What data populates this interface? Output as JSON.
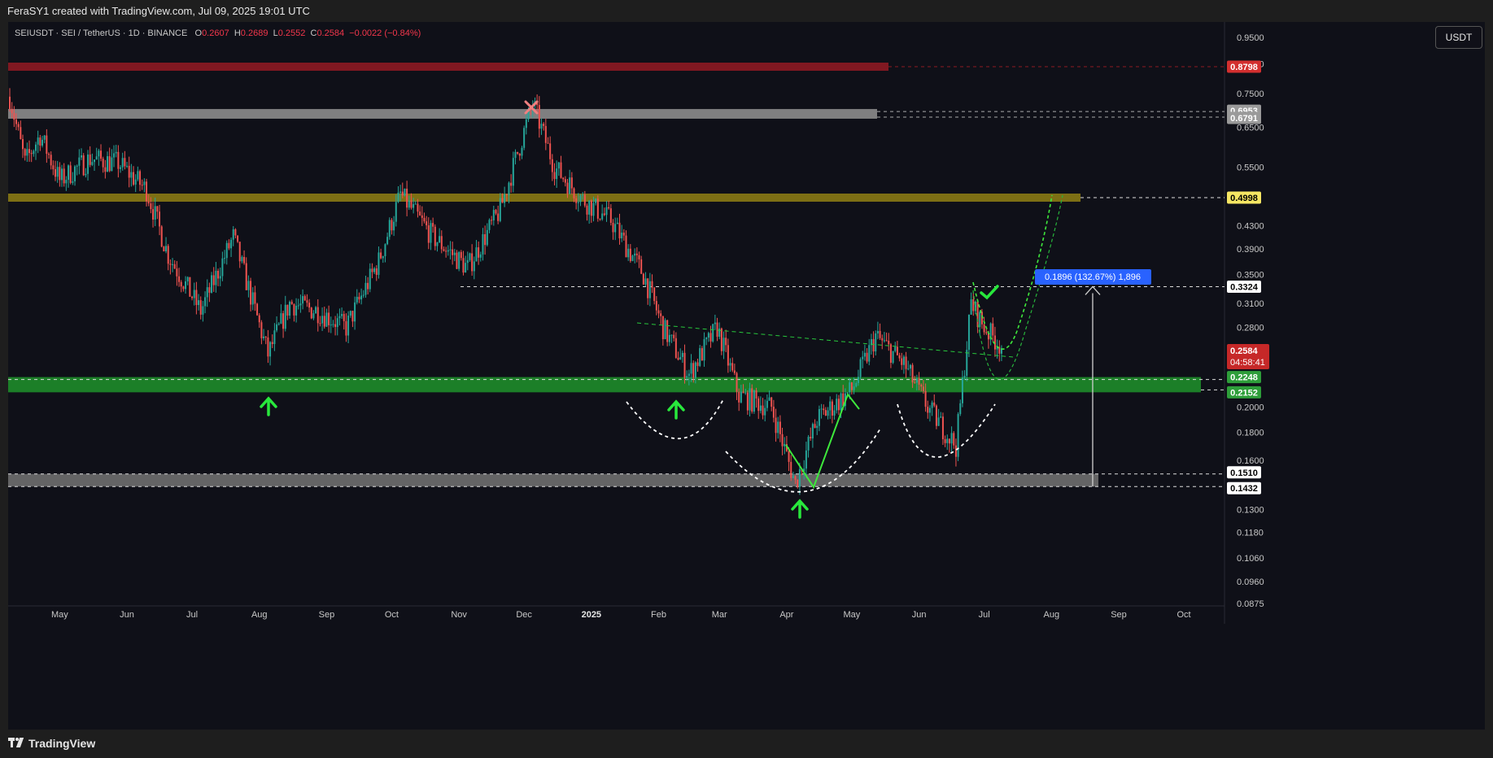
{
  "header": {
    "title": "FeraSY1 created with TradingView.com, Jul 09, 2025 19:01 UTC"
  },
  "footer": {
    "brand": "TradingView"
  },
  "toolbar": {
    "currency_button": "USDT"
  },
  "legend": {
    "symbol": "SEIUSDT · SEI / TetherUS · 1D · BINANCE",
    "o_label": "O",
    "o_value": "0.2607",
    "h_label": "H",
    "h_value": "0.2689",
    "l_label": "L",
    "l_value": "0.2552",
    "c_label": "C",
    "c_value": "0.2584",
    "change": "−0.0022 (−0.84%)"
  },
  "colors": {
    "background": "#0f1018",
    "up": "#26a69a",
    "down": "#ef5350",
    "green_zone": "#1e8c2a",
    "red_zone": "#8e1a22",
    "yellow_zone": "#8a7a14",
    "gray_zone": "#8c8c8c",
    "arrow_green": "#28e83c",
    "measure_label": "#2962ff"
  },
  "chart_data": {
    "type": "candlestick",
    "scale": "log",
    "ylim": [
      0.0875,
      1.0
    ],
    "y_ticks": [
      0.95,
      0.85,
      0.75,
      0.65,
      0.55,
      0.43,
      0.39,
      0.35,
      0.31,
      0.28,
      0.2,
      0.18,
      0.16,
      0.13,
      0.118,
      0.106,
      0.096,
      0.0875
    ],
    "y_tick_labels": [
      "0.9500",
      "0.8500",
      "0.7500",
      "0.6500",
      "0.5500",
      "0.4300",
      "0.3900",
      "0.3500",
      "0.3100",
      "0.2800",
      "0.2000",
      "0.1800",
      "0.1600",
      "0.1300",
      "0.1180",
      "0.1060",
      "0.0960",
      "0.0875"
    ],
    "x_labels": [
      {
        "label": "May",
        "date": "2024-05-01"
      },
      {
        "label": "Jun",
        "date": "2024-06-01"
      },
      {
        "label": "Jul",
        "date": "2024-07-01"
      },
      {
        "label": "Aug",
        "date": "2024-08-01"
      },
      {
        "label": "Sep",
        "date": "2024-09-01"
      },
      {
        "label": "Oct",
        "date": "2024-10-01"
      },
      {
        "label": "Nov",
        "date": "2024-11-01"
      },
      {
        "label": "Dec",
        "date": "2024-12-01"
      },
      {
        "label": "2025",
        "date": "2025-01-01"
      },
      {
        "label": "Feb",
        "date": "2025-02-01"
      },
      {
        "label": "Mar",
        "date": "2025-03-01"
      },
      {
        "label": "Apr",
        "date": "2025-04-01"
      },
      {
        "label": "May",
        "date": "2025-05-01"
      },
      {
        "label": "Jun",
        "date": "2025-06-01"
      },
      {
        "label": "Jul",
        "date": "2025-07-01"
      },
      {
        "label": "Aug",
        "date": "2025-08-01"
      },
      {
        "label": "Sep",
        "date": "2025-09-01"
      },
      {
        "label": "Oct",
        "date": "2025-10-01"
      }
    ],
    "close_path": [
      [
        "2024-04-08",
        0.74
      ],
      [
        "2024-04-15",
        0.56
      ],
      [
        "2024-04-22",
        0.63
      ],
      [
        "2024-05-01",
        0.52
      ],
      [
        "2024-05-15",
        0.57
      ],
      [
        "2024-05-28",
        0.56
      ],
      [
        "2024-06-10",
        0.5
      ],
      [
        "2024-06-20",
        0.38
      ],
      [
        "2024-07-05",
        0.3
      ],
      [
        "2024-07-20",
        0.41
      ],
      [
        "2024-08-05",
        0.25
      ],
      [
        "2024-08-15",
        0.31
      ],
      [
        "2024-08-28",
        0.3
      ],
      [
        "2024-09-10",
        0.28
      ],
      [
        "2024-09-25",
        0.37
      ],
      [
        "2024-10-05",
        0.49
      ],
      [
        "2024-10-20",
        0.41
      ],
      [
        "2024-11-05",
        0.36
      ],
      [
        "2024-11-20",
        0.46
      ],
      [
        "2024-12-05",
        0.72
      ],
      [
        "2024-12-15",
        0.55
      ],
      [
        "2024-12-28",
        0.48
      ],
      [
        "2025-01-10",
        0.44
      ],
      [
        "2025-01-25",
        0.35
      ],
      [
        "2025-02-03",
        0.28
      ],
      [
        "2025-02-15",
        0.23
      ],
      [
        "2025-02-28",
        0.28
      ],
      [
        "2025-03-10",
        0.21
      ],
      [
        "2025-03-25",
        0.2
      ],
      [
        "2025-04-05",
        0.145
      ],
      [
        "2025-04-15",
        0.19
      ],
      [
        "2025-05-01",
        0.215
      ],
      [
        "2025-05-12",
        0.27
      ],
      [
        "2025-05-25",
        0.24
      ],
      [
        "2025-06-05",
        0.2
      ],
      [
        "2025-06-18",
        0.17
      ],
      [
        "2025-06-25",
        0.31
      ],
      [
        "2025-07-01",
        0.28
      ],
      [
        "2025-07-09",
        0.2584
      ]
    ],
    "levels": [
      {
        "name": "red-zone",
        "top": 0.8798,
        "bottom": 0.8798,
        "label": "0.8798"
      },
      {
        "name": "gray-zone-upper",
        "top": 0.6953,
        "bottom": 0.6791,
        "labels": [
          "0.6953",
          "0.6791"
        ]
      },
      {
        "name": "yellow-zone",
        "top": 0.4998,
        "bottom": 0.4998,
        "label": "0.4998"
      },
      {
        "name": "neckline",
        "value": 0.3324,
        "label": "0.3324"
      },
      {
        "name": "green-zone",
        "top": 0.2248,
        "bottom": 0.2152,
        "labels": [
          "0.2248",
          "0.2152"
        ]
      },
      {
        "name": "gray-zone-lower",
        "top": 0.151,
        "bottom": 0.1432,
        "labels": [
          "0.1510",
          "0.1432"
        ]
      }
    ],
    "last_price": {
      "value": "0.2584",
      "countdown": "04:58:41"
    },
    "measure": {
      "from": 0.1432,
      "to": 0.3324,
      "date": "2025-08-20",
      "label": "0.1896 (132.67%) 1,896"
    },
    "annotations": [
      {
        "type": "arrow-up",
        "date": "2024-08-05",
        "price": 0.22
      },
      {
        "type": "arrow-up",
        "date": "2025-02-10",
        "price": 0.19
      },
      {
        "type": "arrow-up",
        "date": "2025-04-08",
        "price": 0.137
      },
      {
        "type": "x-mark",
        "date": "2024-12-05",
        "price": 0.76
      },
      {
        "type": "check-mark",
        "date": "2025-07-02",
        "price": 0.34
      }
    ]
  }
}
